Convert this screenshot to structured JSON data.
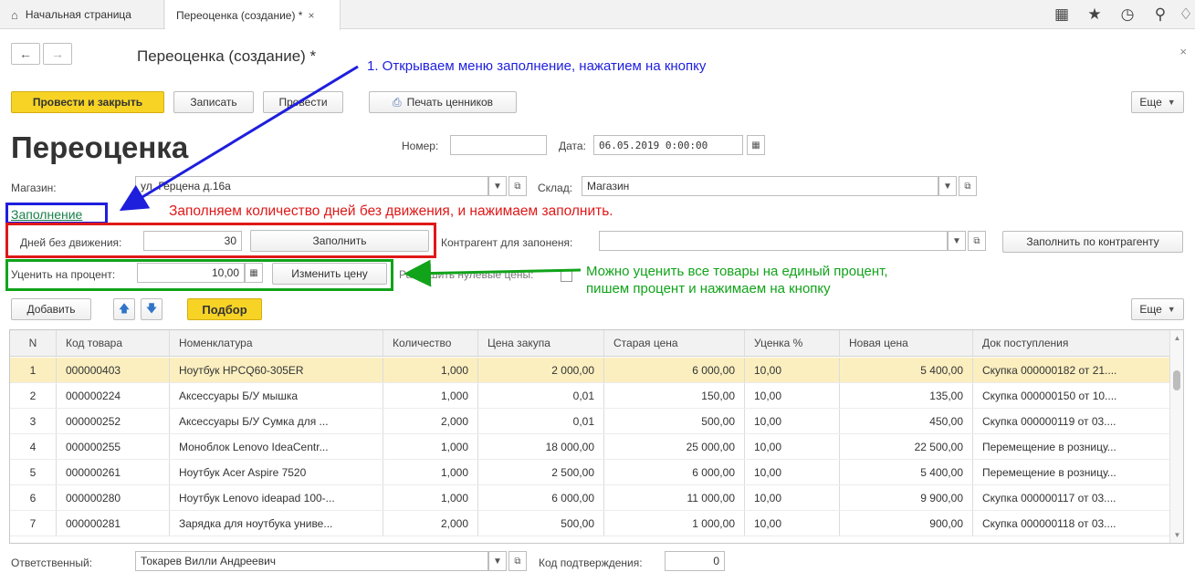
{
  "tabs": {
    "home": "Начальная страница",
    "active": "Переоценка (создание) *"
  },
  "icons": {
    "home": "home-icon",
    "apps": "apps-grid-icon",
    "star": "star-icon",
    "history": "history-icon",
    "search": "search-icon",
    "bell": "bell-icon"
  },
  "header": {
    "title": "Переоценка (создание) *"
  },
  "toolbar": {
    "post_close": "Провести и закрыть",
    "save": "Записать",
    "post": "Провести",
    "print": "Печать ценников",
    "more": "Еще"
  },
  "doc": {
    "title": "Переоценка",
    "number_label": "Номер:",
    "number_value": "",
    "date_label": "Дата:",
    "date_value": "06.05.2019  0:00:00",
    "store_label": "Магазин:",
    "store_value": "ул. Герцена д.16а",
    "warehouse_label": "Склад:",
    "warehouse_value": "Магазин",
    "fill_link": "Заполнение",
    "days_label": "Дней без движения:",
    "days_value": "30",
    "fill_button": "Заполнить",
    "contractor_label": "Контрагент для запоненя:",
    "contractor_value": "",
    "fill_by_contractor": "Заполнить по контрагенту",
    "discount_label": "Уценить на процент:",
    "discount_value": "10,00",
    "change_price": "Изменить цену",
    "zero_prices_label": "Разрешить нулевые цены:",
    "responsible_label": "Ответственный:",
    "responsible_value": "Токарев Вилли Андреевич",
    "confirm_label": "Код подтверждения:",
    "confirm_value": "0"
  },
  "table_toolbar": {
    "add": "Добавить",
    "pick": "Подбор",
    "more": "Еще"
  },
  "annotations": {
    "blue": "1. Открываем меню заполнение, нажатием на кнопку",
    "red": "Заполняем количество дней без движения, и нажимаем заполнить.",
    "green_1": "Можно уценить все товары на единый процент,",
    "green_2": "пишем процент и нажимаем на кнопку"
  },
  "colors": {
    "blue": "#1e1edd",
    "red": "#e01818",
    "green": "#11a31a",
    "primary_button": "#f6d325",
    "selected_row": "#fbefc0"
  },
  "table": {
    "columns": [
      "N",
      "Код товара",
      "Номенклатура",
      "Количество",
      "Цена закупа",
      "Старая цена",
      "Уценка %",
      "Новая цена",
      "Док поступления"
    ],
    "rows": [
      [
        "1",
        "000000403",
        "Ноутбук HPCQ60-305ER",
        "1,000",
        "2 000,00",
        "6 000,00",
        "10,00",
        "5 400,00",
        "Скупка 000000182 от 21...."
      ],
      [
        "2",
        "000000224",
        "Аксессуары Б/У мышка",
        "1,000",
        "0,01",
        "150,00",
        "10,00",
        "135,00",
        "Скупка 000000150 от 10...."
      ],
      [
        "3",
        "000000252",
        "Аксессуары Б/У Сумка для ...",
        "2,000",
        "0,01",
        "500,00",
        "10,00",
        "450,00",
        "Скупка 000000119 от 03...."
      ],
      [
        "4",
        "000000255",
        "Моноблок Lenovo IdeaCentr...",
        "1,000",
        "18 000,00",
        "25 000,00",
        "10,00",
        "22 500,00",
        "Перемещение в розницу..."
      ],
      [
        "5",
        "000000261",
        "Ноутбук Acer Aspire 7520",
        "1,000",
        "2 500,00",
        "6 000,00",
        "10,00",
        "5 400,00",
        "Перемещение в розницу..."
      ],
      [
        "6",
        "000000280",
        "Ноутбук Lenovo ideapad 100-...",
        "1,000",
        "6 000,00",
        "11 000,00",
        "10,00",
        "9 900,00",
        "Скупка 000000117 от 03...."
      ],
      [
        "7",
        "000000281",
        "Зарядка для ноутбука униве...",
        "2,000",
        "500,00",
        "1 000,00",
        "10,00",
        "900,00",
        "Скупка 000000118 от 03...."
      ]
    ]
  }
}
